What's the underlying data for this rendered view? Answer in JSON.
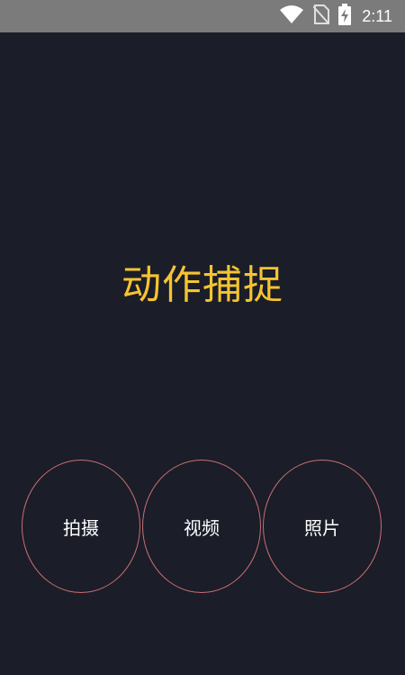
{
  "status_bar": {
    "time": "2:11",
    "icons": [
      "wifi-icon",
      "no-sim-icon",
      "battery-charging-icon"
    ]
  },
  "main": {
    "title": "动作捕捉",
    "buttons": [
      {
        "label": "拍摄"
      },
      {
        "label": "视频"
      },
      {
        "label": "照片"
      }
    ]
  },
  "colors": {
    "background": "#1b1d28",
    "status_bar": "#7b7b7b",
    "title": "#f5c431",
    "button_border": "#c66f73",
    "button_text": "#ffffff"
  }
}
